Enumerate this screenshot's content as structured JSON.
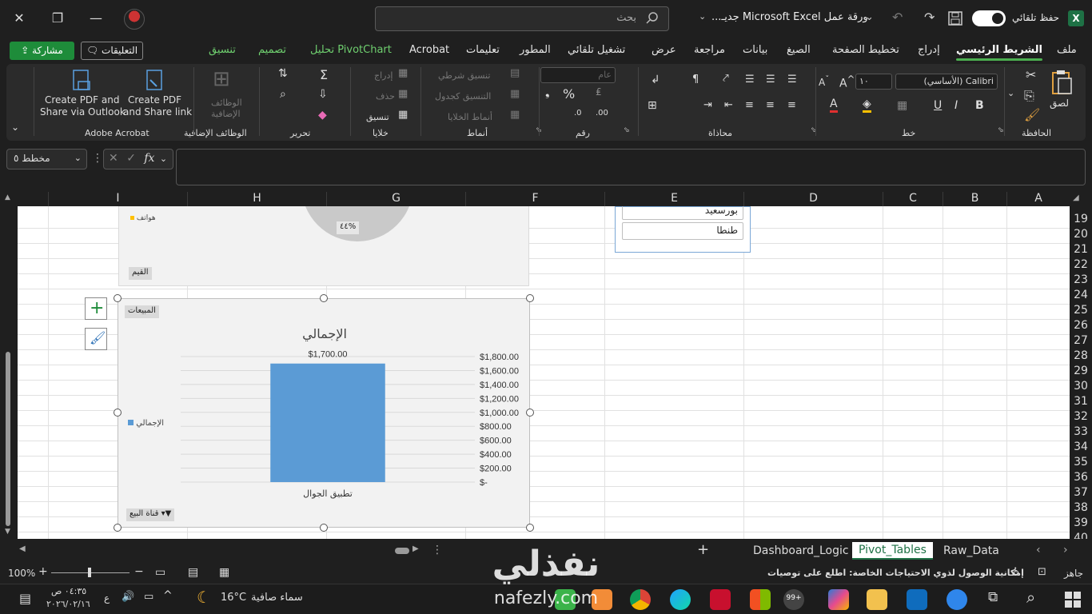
{
  "titlebar": {
    "autosave_label": "حفظ تلقائي",
    "doc_title": "ورقة عمل Microsoft Excel جديـ...",
    "search_placeholder": "بحث"
  },
  "tabs": [
    {
      "label": "ملف"
    },
    {
      "label": "الشريط الرئيسي"
    },
    {
      "label": "إدراج"
    },
    {
      "label": "تخطيط الصفحة"
    },
    {
      "label": "الصيغ"
    },
    {
      "label": "بيانات"
    },
    {
      "label": "مراجعة"
    },
    {
      "label": "عرض"
    },
    {
      "label": "تشغيل تلقائي"
    },
    {
      "label": "المطور"
    },
    {
      "label": "تعليمات"
    },
    {
      "label": "Acrobat"
    },
    {
      "label": "تحليل PivotChart"
    },
    {
      "label": "تصميم"
    },
    {
      "label": "تنسيق"
    }
  ],
  "share_label": "مشاركة",
  "comments_label": "التعليقات",
  "ribbon": {
    "groups": {
      "clipboard": "الحافظة",
      "font": "خط",
      "alignment": "محاذاة",
      "number": "رقم",
      "styles": "أنماط",
      "cells": "خلايا",
      "editing": "تحرير",
      "addins": "الوظائف الإضافية",
      "acrobat": "Adobe Acrobat"
    },
    "paste_label": "لصق",
    "font_name": "Calibri (الأساسي)",
    "font_size": "١٠",
    "number_format": "عام",
    "conditional_formatting": "تنسيق شرطي",
    "format_as_table": "التنسيق كجدول",
    "cell_styles": "أنماط الخلايا",
    "insert": "إدراج",
    "delete": "حذف",
    "format": "تنسيق",
    "addins_label_1": "الوظائف",
    "addins_label_2": "الإضافية",
    "acrobat_outlook_1": "Create PDF and",
    "acrobat_outlook_2": "Share via Outlook",
    "acrobat_link_1": "Create PDF",
    "acrobat_link_2": "and Share link"
  },
  "namebox_value": "مخطط ٥",
  "columns": [
    "A",
    "B",
    "C",
    "D",
    "E",
    "F",
    "G",
    "H",
    "I"
  ],
  "rows": [
    "19",
    "20",
    "21",
    "22",
    "23",
    "24",
    "25",
    "26",
    "27",
    "28",
    "29",
    "30",
    "31",
    "32",
    "33",
    "34",
    "35",
    "36",
    "37",
    "38",
    "39",
    "40"
  ],
  "slicer": {
    "items": [
      "بورسعيد",
      "طنطا"
    ]
  },
  "pie_chart": {
    "legend_item": "هواتف",
    "data_label": "٤٤%",
    "values_button": "القيم"
  },
  "chart_data": {
    "type": "bar",
    "title": "الإجمالي",
    "categories": [
      "تطبيق الجوال"
    ],
    "series": [
      {
        "name": "الإجمالي",
        "values": [
          1700
        ]
      }
    ],
    "data_labels": [
      "$1,700.00"
    ],
    "ylim": [
      0,
      1800
    ],
    "yticks": [
      "$-",
      "$200.00",
      "$400.00",
      "$600.00",
      "$800.00",
      "$1,000.00",
      "$1,200.00",
      "$1,400.00",
      "$1,600.00",
      "$1,800.00"
    ],
    "legend_position": "right",
    "grid": true,
    "field_buttons": {
      "values": "المبيعات",
      "axis": "قناة البيع"
    },
    "colors": {
      "bar": "#5b9bd5"
    }
  },
  "sheet_tabs": [
    "Dashboard_Logic",
    "Pivot_Tables",
    "Raw_Data"
  ],
  "active_sheet": "Pivot_Tables",
  "status": {
    "ready": "جاهز",
    "accessibility": "إمكانية الوصول لذوي الاحتياجات الخاصة: اطلع على توصيات",
    "zoom": "100%"
  },
  "taskbar": {
    "weather_temp": "16°C",
    "weather_text": "سماء صافية",
    "time": "٠٤:٣٥ ص",
    "date": "٢٠٢٦/٠٢/١٦",
    "lang": "ع",
    "badge": "99+"
  },
  "watermark": {
    "brand_ar": "نفذلي",
    "brand_en": "nafezly.com"
  }
}
